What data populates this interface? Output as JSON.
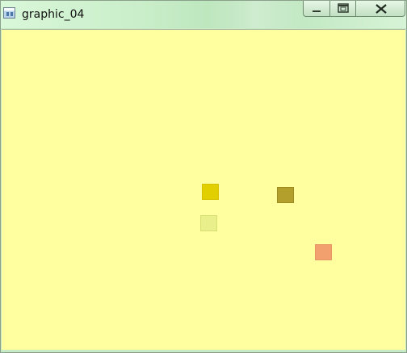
{
  "window": {
    "title": "graphic_04",
    "icon": "application-window-icon",
    "controls": {
      "minimize": "minimize-icon",
      "maximize": "maximize-icon",
      "close": "close-icon"
    }
  },
  "canvas": {
    "background": "#FFFF9F",
    "shapes": [
      {
        "name": "gold-square",
        "color": "#E2CF00"
      },
      {
        "name": "olive-square",
        "color": "#B39F2C"
      },
      {
        "name": "pale-lime-square",
        "color": "#E8EF8B"
      },
      {
        "name": "orange-square",
        "color": "#F2A06D"
      }
    ]
  }
}
